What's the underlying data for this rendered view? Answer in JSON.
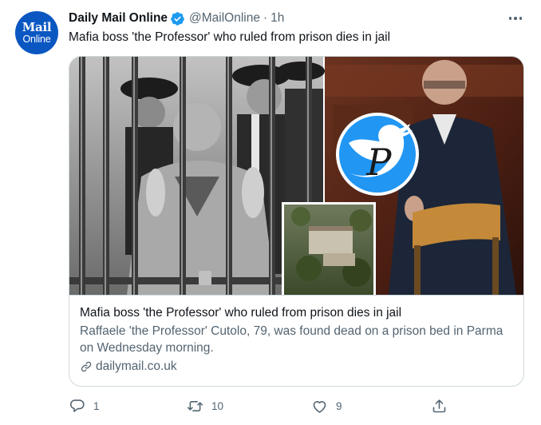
{
  "author": {
    "avatar_line1": "Mail",
    "avatar_line2": "Online",
    "name": "Daily Mail Online",
    "handle": "@MailOnline",
    "separator": "·",
    "time": "1h"
  },
  "tweet": {
    "text": "Mafia boss 'the Professor' who ruled from prison dies in jail"
  },
  "card": {
    "title": "Mafia boss 'the Professor' who ruled from prison dies in jail",
    "description": "Raffaele 'the Professor' Cutolo, 79, was found dead on a prison bed in Parma on Wednesday morning.",
    "domain": "dailymail.co.uk",
    "watermark_letter": "P"
  },
  "actions": {
    "reply_count": "1",
    "retweet_count": "10",
    "like_count": "9"
  },
  "colors": {
    "brand_blue": "#1d9bf0",
    "avatar_blue": "#0b57c2",
    "secondary_text": "#536471",
    "border": "#cfd9de"
  },
  "icons": {
    "verified": "verified-badge-icon",
    "more": "more-dots-icon",
    "link": "link-icon",
    "reply": "reply-icon",
    "retweet": "retweet-icon",
    "like": "heart-icon",
    "share": "share-icon"
  }
}
